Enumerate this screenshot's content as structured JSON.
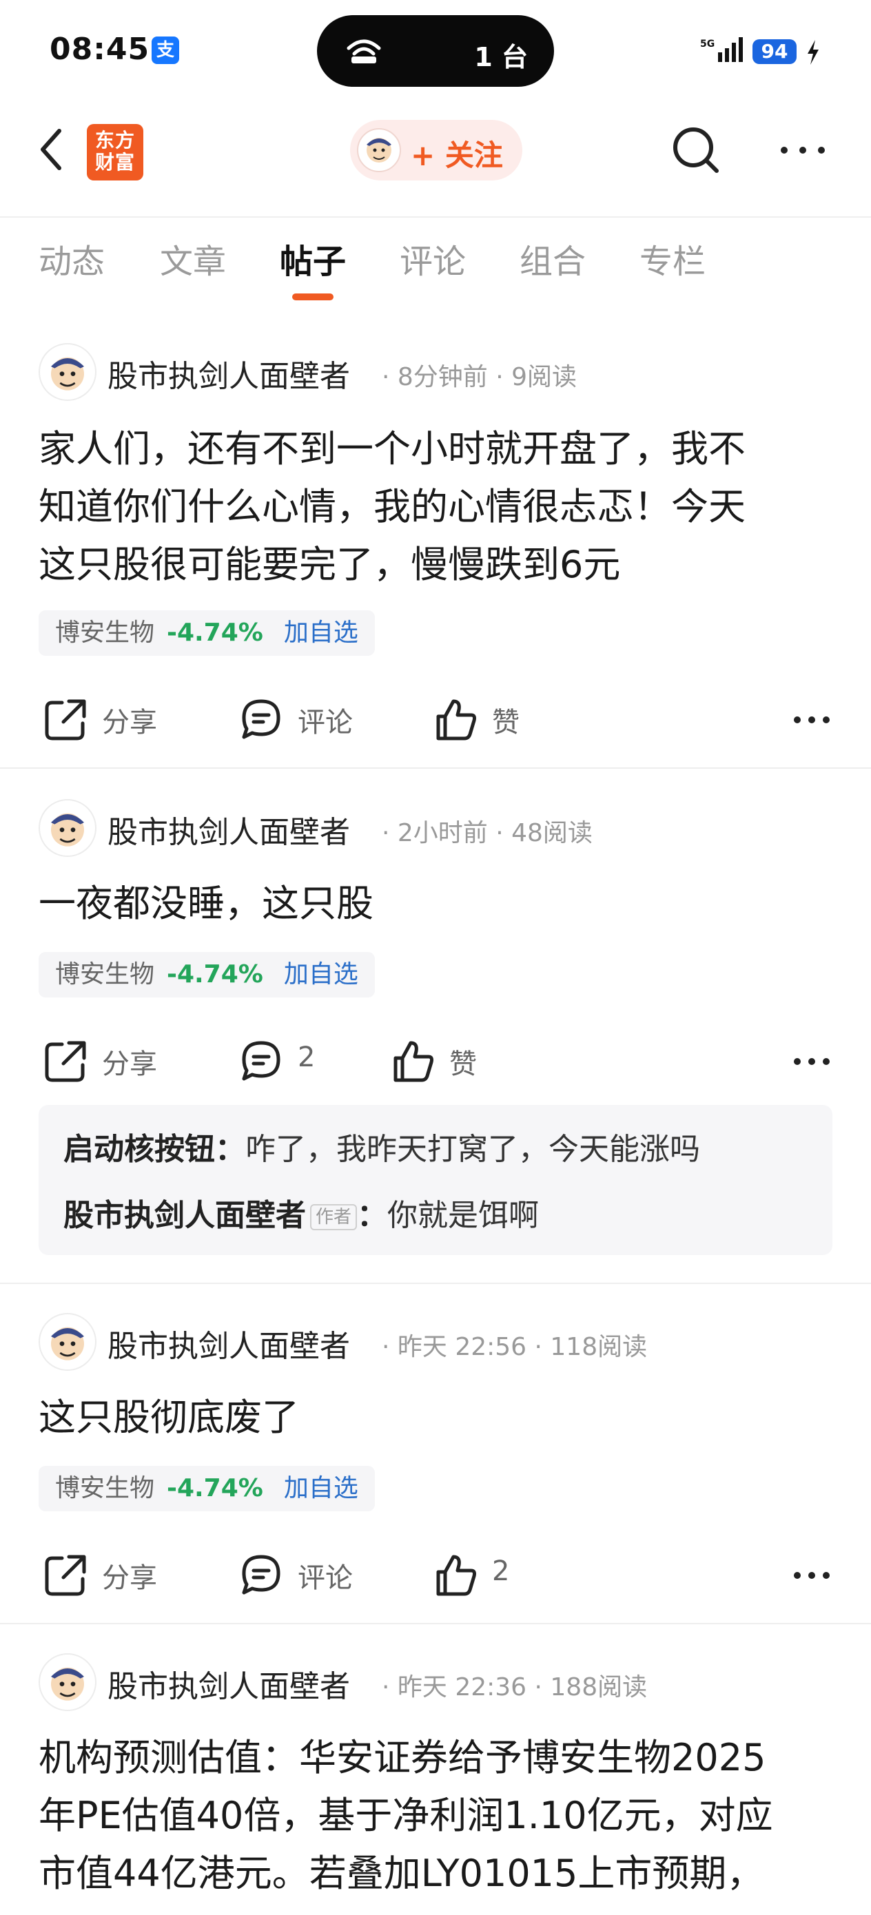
{
  "status_bar": {
    "time": "08:45",
    "alipay_icon_label": "支",
    "island_text": "1 台",
    "network": "5G",
    "battery": "94"
  },
  "nav": {
    "logo_text_line1": "东方",
    "logo_text_line2": "财富",
    "follow_label": "+ 关注"
  },
  "tabs": [
    {
      "label": "动态",
      "active": false
    },
    {
      "label": "文章",
      "active": false
    },
    {
      "label": "帖子",
      "active": true
    },
    {
      "label": "评论",
      "active": false
    },
    {
      "label": "组合",
      "active": false
    },
    {
      "label": "专栏",
      "active": false
    }
  ],
  "posts": [
    {
      "author": "股市执剑人面壁者",
      "meta": "· 8分钟前 · 9阅读",
      "body_lines": [
        "家人们，还有不到一个小时就开盘了，我不",
        "知道你们什么心情，我的心情很忐忑！今天",
        "这只股很可能要完了，慢慢跌到6元"
      ],
      "stock": {
        "name": "博安生物",
        "change": "-4.74%",
        "add_label": "加自选"
      },
      "share_label": "分享",
      "comment_label": "评论",
      "like_label": "赞"
    },
    {
      "author": "股市执剑人面壁者",
      "meta": "· 2小时前 · 48阅读",
      "body_lines": [
        "一夜都没睡，这只股"
      ],
      "stock": {
        "name": "博安生物",
        "change": "-4.74%",
        "add_label": "加自选"
      },
      "share_label": "分享",
      "comment_label": "2",
      "like_label": "赞",
      "comments": [
        {
          "user": "启动核按钮",
          "sep": "：",
          "text": "咋了，我昨天打窝了，今天能涨吗",
          "is_author": false
        },
        {
          "user": "股市执剑人面壁者",
          "tag": "作者",
          "sep": "：",
          "text": "你就是饵啊",
          "is_author": true
        }
      ]
    },
    {
      "author": "股市执剑人面壁者",
      "meta": "· 昨天 22:56 · 118阅读",
      "body_lines": [
        "这只股彻底废了"
      ],
      "stock": {
        "name": "博安生物",
        "change": "-4.74%",
        "add_label": "加自选"
      },
      "share_label": "分享",
      "comment_label": "评论",
      "like_label": "2"
    },
    {
      "author": "股市执剑人面壁者",
      "meta": "· 昨天 22:36 · 188阅读",
      "body_lines": [
        "机构预测估值：华安证券给予博安生物2025",
        "年PE估值40倍，基于净利润1.10亿元，对应",
        "市值44亿港元。若叠加LY01015上市预期，"
      ]
    }
  ],
  "colors": {
    "brand_orange": "#f05a22",
    "stock_down_green": "#23a55a",
    "link_blue": "#2b6fc9"
  }
}
